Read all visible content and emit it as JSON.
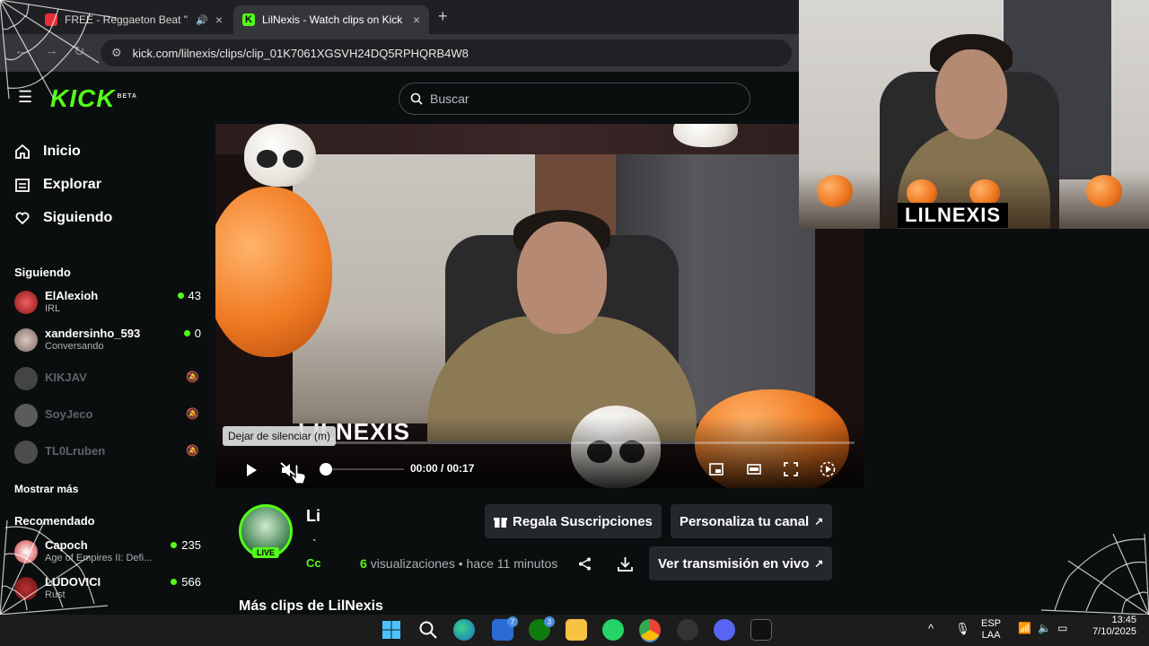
{
  "browser": {
    "tabs": [
      {
        "title": "FREE - Reggaeton Beat \"SU",
        "active": false
      },
      {
        "title": "LilNexis - Watch clips on Kick",
        "active": true
      }
    ],
    "close_glyph": "×",
    "new_tab_glyph": "+",
    "url": "kick.com/lilnexis/clips/clip_01K7061XGSVH24DQ5RPHQRB4W8"
  },
  "header": {
    "logo": "KICK",
    "logo_beta": "BETA",
    "search_placeholder": "Buscar"
  },
  "sidebar": {
    "nav": [
      {
        "label": "Inicio",
        "icon": "home-icon"
      },
      {
        "label": "Explorar",
        "icon": "browse-icon"
      },
      {
        "label": "Siguiendo",
        "icon": "heart-icon"
      }
    ],
    "following_title": "Siguiendo",
    "following": [
      {
        "name": "ElAlexioh",
        "category": "IRL",
        "viewers": "43",
        "online": true
      },
      {
        "name": "xandersinho_593",
        "category": "Conversando",
        "viewers": "0",
        "online": true
      },
      {
        "name": "KIKJAV",
        "online": false
      },
      {
        "name": "SoyJeco",
        "online": false
      },
      {
        "name": "TL0Lruben",
        "online": false
      }
    ],
    "show_more": "Mostrar más",
    "recommended_title": "Recomendado",
    "recommended": [
      {
        "name": "Capoch",
        "category": "Age of Empires II: Defi...",
        "viewers": "235"
      },
      {
        "name": "LUDOVICI",
        "category": "Rust",
        "viewers": "566"
      }
    ]
  },
  "player": {
    "overlay_name": "LILNEXIS",
    "tooltip": "Dejar de silenciar (m)",
    "time": "00:00 / 00:17",
    "progress": 0,
    "volume": 0
  },
  "clip": {
    "title": "Li",
    "subtitle_mark": "`",
    "channel_short": "Cc",
    "live_badge": "LIVE",
    "views_count": "6",
    "views_label": "visualizaciones",
    "separator": "•",
    "age": "hace 11 minutos",
    "gift_button": "Regala Suscripciones",
    "customize_button": "Personaliza tu canal",
    "watch_live_button": "Ver transmisión en vivo",
    "more_clips_title": "Más clips de LilNexis"
  },
  "webcam": {
    "name_plate": "LILNEXIS"
  },
  "taskbar": {
    "edge_badge": "7",
    "xbox_badge": "3",
    "lang_top": "ESP",
    "lang_bottom": "LAA",
    "clock_time": "13:45",
    "clock_date": "7/10/2025"
  },
  "colors": {
    "kick_green": "#53fc18",
    "background": "#0b0e0f",
    "button_bg": "#24272c"
  }
}
